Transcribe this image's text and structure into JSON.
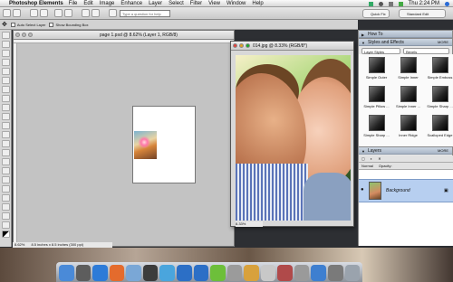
{
  "menubar": {
    "app_name": "Photoshop Elements",
    "items": [
      "File",
      "Edit",
      "Image",
      "Enhance",
      "Layer",
      "Select",
      "Filter",
      "View",
      "Window",
      "Help"
    ],
    "clock": "Thu 2:24 PM"
  },
  "toolbar": {
    "search_placeholder": "Type a question for help",
    "quick_fix": "Quick Fix",
    "standard_edit": "Standard Edit"
  },
  "options": {
    "auto_select_label": "Auto Select Layer",
    "show_bbox_label": "Show Bounding Box"
  },
  "doc1": {
    "title": "page 1.psd @ 8.62% (Layer 1, RGB/8)",
    "zoom": "8.62%",
    "size": "8.5 inches x 8.5 inches (300 ppi)"
  },
  "doc2": {
    "title": "014.jpg @ 8.33% (RGB/8*)",
    "zoom": "8.33%"
  },
  "palettes": {
    "howto": "How To",
    "styles": "Styles and Effects",
    "more": "MORE",
    "selects": [
      "Layer Styles",
      "Bevels"
    ],
    "styles_items": [
      "Simple Outer",
      "Simple Inner",
      "Simple Emboss",
      "Simple Pillow ...",
      "Simple Inner ...",
      "Simple Sharp ...",
      "Simple Sharp ...",
      "Inner Ridge",
      "Scalloped Edge"
    ],
    "layers_title": "Layers",
    "blend": "Normal",
    "opacity_label": "Opacity:",
    "layer_name": "Background"
  }
}
